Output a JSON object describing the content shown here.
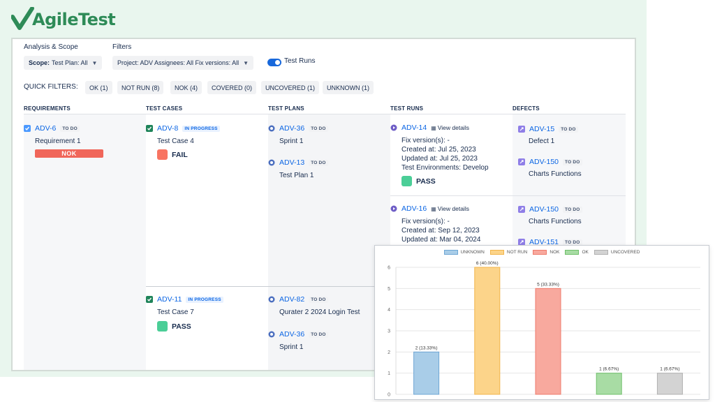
{
  "brand": {
    "logo_text": "AgileTest",
    "logo_color": "#2e8b57"
  },
  "header": {
    "analysis_scope_label": "Analysis & Scope",
    "filters_label": "Filters",
    "scope_dropdown": {
      "prefix": "Scope:",
      "value": "Test Plan: All"
    },
    "filter_dropdown": {
      "value": "Project: ADV Assignees: All Fix versions: All"
    },
    "test_runs_toggle": {
      "label": "Test Runs",
      "on": true
    }
  },
  "quick_filters": {
    "label": "QUICK FILTERS:",
    "buttons": [
      "OK (1)",
      "NOT RUN (8)",
      "NOK (4)",
      "COVERED (0)",
      "UNCOVERED (1)",
      "UNKNOWN (1)"
    ]
  },
  "columns": [
    "REQUIREMENTS",
    "TEST CASES",
    "TEST PLANS",
    "TEST RUNS",
    "DEFECTS"
  ],
  "requirement": {
    "key": "ADV-6",
    "badge": "TO DO",
    "title": "Requirement 1",
    "status": "NOK"
  },
  "test_cases": [
    {
      "key": "ADV-8",
      "badge": "IN PROGRESS",
      "title": "Test Case 4",
      "status": "FAIL",
      "status_color": "#f87462"
    },
    {
      "key": "ADV-11",
      "badge": "IN PROGRESS",
      "title": "Test Case 7",
      "status": "PASS",
      "status_color": "#4bce97"
    }
  ],
  "test_plans": [
    {
      "key": "ADV-36",
      "badge": "TO DO",
      "title": "Sprint 1"
    },
    {
      "key": "ADV-13",
      "badge": "TO DO",
      "title": "Test Plan 1"
    },
    {
      "key": "ADV-82",
      "badge": "TO DO",
      "title": "Qurater 2 2024 Login Test"
    },
    {
      "key": "ADV-36",
      "badge": "TO DO",
      "title": "Sprint 1"
    }
  ],
  "test_runs": [
    {
      "key": "ADV-14",
      "view": "View details",
      "lines": [
        "Fix version(s): -",
        "Created at: Jul 25, 2023",
        "Updated at: Jul 25, 2023",
        "Test Environments: Develop"
      ],
      "status": "PASS",
      "status_color": "#4bce97"
    },
    {
      "key": "ADV-16",
      "view": "View details",
      "lines": [
        "Fix version(s): -",
        "Created at: Sep 12, 2023",
        "Updated at: Mar 04, 2024"
      ]
    }
  ],
  "defects": [
    {
      "key": "ADV-15",
      "badge": "TO DO",
      "title": "Defect 1"
    },
    {
      "key": "ADV-150",
      "badge": "TO DO",
      "title": "Charts Functions"
    },
    {
      "key": "ADV-150",
      "badge": "TO DO",
      "title": "Charts Functions"
    },
    {
      "key": "ADV-151",
      "badge": "TO DO",
      "title": ""
    }
  ],
  "chart_data": {
    "type": "bar",
    "categories": [
      "UNKNOWN",
      "NOT RUN",
      "NOK",
      "OK",
      "UNCOVERED"
    ],
    "values": [
      2,
      6,
      5,
      1,
      1
    ],
    "data_labels": [
      "2 (13.33%)",
      "6 (40.00%)",
      "5 (33.33%)",
      "1 (6.67%)",
      "1 (6.67%)"
    ],
    "colors": [
      "#a9cde8",
      "#fcd48a",
      "#f8a99e",
      "#a8dca4",
      "#d3d3d3"
    ],
    "border_colors": [
      "#6ea6d4",
      "#f2b54a",
      "#ee7b6c",
      "#6fbf6a",
      "#b0b0b0"
    ],
    "ylim": [
      0,
      6
    ],
    "yticks": [
      "0",
      "1",
      "2",
      "3",
      "4",
      "5",
      "6"
    ],
    "legend_position": "top",
    "grid": true,
    "title": "",
    "xlabel": "",
    "ylabel": ""
  }
}
